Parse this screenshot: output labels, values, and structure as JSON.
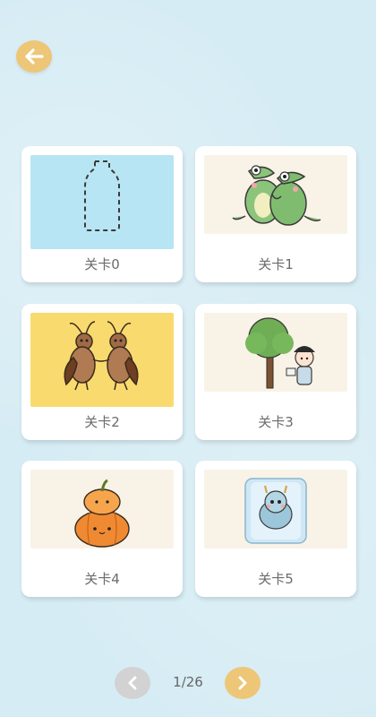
{
  "header": {
    "back_icon": "arrow-left-icon",
    "accent": "#edc677"
  },
  "levels": [
    {
      "label": "关卡0",
      "thumb": "bottle-outline",
      "bg": "#b7e5f3"
    },
    {
      "label": "关卡1",
      "thumb": "crocodiles-hugging",
      "bg": "#f8f3e6"
    },
    {
      "label": "关卡2",
      "thumb": "cockroaches-holding-hands",
      "bg": "#f8da6f"
    },
    {
      "label": "关卡3",
      "thumb": "tree-and-boy",
      "bg": "#f8f3e6"
    },
    {
      "label": "关卡4",
      "thumb": "stacked-pumpkins",
      "bg": "#f8f3e6"
    },
    {
      "label": "关卡5",
      "thumb": "dragon-in-ice-cube",
      "bg": "#f8f3e6"
    }
  ],
  "pager": {
    "current": "1/26",
    "prev_icon": "chevron-left-icon",
    "next_icon": "chevron-right-icon"
  }
}
